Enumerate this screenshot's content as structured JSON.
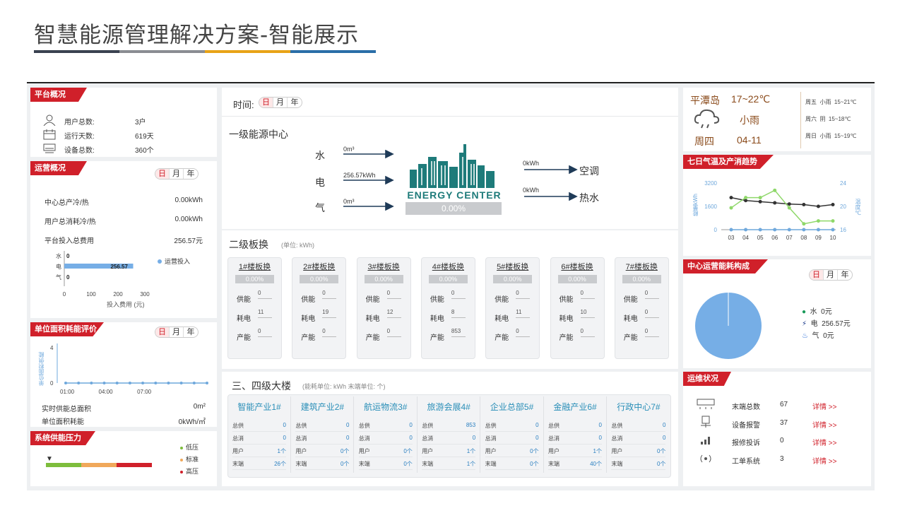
{
  "page": {
    "title": "智慧能源管理解决方案-智能展示",
    "title_bar_colors": [
      "#3a4250",
      "#8a8d92",
      "#e8a317",
      "#2a6ea8"
    ]
  },
  "platform": {
    "tag": "平台概况",
    "rows": [
      {
        "icon": "user-icon",
        "label": "用户总数:",
        "value": "3户"
      },
      {
        "icon": "calendar-icon",
        "label": "运行天数:",
        "value": "619天"
      },
      {
        "icon": "device-icon",
        "label": "设备总数:",
        "value": "360个"
      }
    ]
  },
  "operation": {
    "tag": "运营概况",
    "toggle": [
      "日",
      "月",
      "年"
    ],
    "rows": [
      {
        "label": "中心总产冷/热",
        "value": "0.00kWh"
      },
      {
        "label": "用户总消耗冷/热",
        "value": "0.00kWh"
      },
      {
        "label": "平台投入总费用",
        "value": "256.57元"
      }
    ],
    "legend": "运营投入",
    "xlabel": "投入费用 (元)"
  },
  "op_chart": {
    "type": "bar",
    "categories": [
      "水",
      "电",
      "气"
    ],
    "values": [
      0,
      256.57,
      0
    ],
    "value_labels": [
      "0",
      "256.57",
      "0"
    ],
    "xticks": [
      "0",
      "100",
      "200",
      "300"
    ],
    "xlim": [
      0,
      300
    ]
  },
  "unit_area": {
    "tag": "单位面积耗能评价",
    "toggle": [
      "日",
      "月",
      "年"
    ],
    "ylabel": "单位面积供能",
    "rows": [
      {
        "label": "实时供能总面积",
        "value": "0m²"
      },
      {
        "label": "单位面积耗能",
        "value": "0kWh/㎡"
      }
    ]
  },
  "unit_chart": {
    "type": "line",
    "yticks": [
      "4",
      "0"
    ],
    "xticks": [
      "01:00",
      "04:00",
      "07:00"
    ],
    "ylim": [
      0,
      4
    ],
    "points": [
      0,
      0,
      0,
      0,
      0,
      0,
      0,
      0,
      0,
      0,
      0,
      0
    ]
  },
  "pressure": {
    "tag": "系统供能压力",
    "legend": [
      {
        "label": "低压",
        "color": "#7dbd3c"
      },
      {
        "label": "标准",
        "color": "#f0a85a"
      },
      {
        "label": "高压",
        "color": "#d0202a"
      }
    ]
  },
  "center": {
    "time_label": "时间:",
    "toggle": [
      "日",
      "月",
      "年"
    ],
    "primary_title": "一级能源中心",
    "inputs": [
      {
        "name": "水",
        "value": "0m³"
      },
      {
        "name": "电",
        "value": "256.57kWh"
      },
      {
        "name": "气",
        "value": "0m³"
      }
    ],
    "center_label": "ENERGY CENTER",
    "center_percent": "0.00%",
    "outputs": [
      {
        "value": "0kWh",
        "name": "空调"
      },
      {
        "value": "0kWh",
        "name": "热水"
      }
    ]
  },
  "exchangers": {
    "title": "二级板换",
    "unit": "(单位: kWh)",
    "labels": [
      "供能",
      "耗电",
      "产能"
    ],
    "cards": [
      {
        "name": "1#楼板换",
        "percent": "0.00%",
        "supply": "0",
        "power": "11",
        "produce": "0"
      },
      {
        "name": "2#楼板换",
        "percent": "0.00%",
        "supply": "0",
        "power": "19",
        "produce": "0"
      },
      {
        "name": "3#楼板换",
        "percent": "0.00%",
        "supply": "0",
        "power": "12",
        "produce": "0"
      },
      {
        "name": "4#楼板换",
        "percent": "0.00%",
        "supply": "0",
        "power": "8",
        "produce": "853"
      },
      {
        "name": "5#楼板换",
        "percent": "0.00%",
        "supply": "0",
        "power": "11",
        "produce": "0"
      },
      {
        "name": "6#楼板换",
        "percent": "0.00%",
        "supply": "0",
        "power": "10",
        "produce": "0"
      },
      {
        "name": "7#楼板换",
        "percent": "0.00%",
        "supply": "0",
        "power": "0",
        "produce": "0"
      }
    ]
  },
  "buildings": {
    "title": "三、四级大楼",
    "unit": "(能耗单位: kWh  末端单位: 个)",
    "labels": [
      "总供",
      "总消",
      "用户",
      "末端"
    ],
    "items": [
      {
        "name": "智能产业1#",
        "supply": "0",
        "consume": "0",
        "users": "1个",
        "ends": "26个"
      },
      {
        "name": "建筑产业2#",
        "supply": "0",
        "consume": "0",
        "users": "0个",
        "ends": "0个"
      },
      {
        "name": "航运物流3#",
        "supply": "0",
        "consume": "0",
        "users": "0个",
        "ends": "0个"
      },
      {
        "name": "旅游会展4#",
        "supply": "853",
        "consume": "0",
        "users": "1个",
        "ends": "1个"
      },
      {
        "name": "企业总部5#",
        "supply": "0",
        "consume": "0",
        "users": "0个",
        "ends": "0个"
      },
      {
        "name": "金融产业6#",
        "supply": "0",
        "consume": "0",
        "users": "1个",
        "ends": "40个"
      },
      {
        "name": "行政中心7#",
        "supply": "0",
        "consume": "0",
        "users": "0个",
        "ends": "0个"
      }
    ]
  },
  "weather": {
    "city": "平潭岛",
    "temp": "17~22℃",
    "condition": "小雨",
    "weekday": "周四",
    "date": "04-11",
    "forecast": [
      {
        "day": "周五",
        "cond": "小雨",
        "temp": "15~21℃"
      },
      {
        "day": "周六",
        "cond": "阴",
        "temp": "15~18℃"
      },
      {
        "day": "周日",
        "cond": "小雨",
        "temp": "15~19℃"
      }
    ]
  },
  "trend": {
    "tag": "七日气温及产消趋势",
    "ylabel_left": "能量kWh",
    "ylabel_right": "温度℃"
  },
  "trend_chart": {
    "type": "line",
    "x": [
      "03",
      "04",
      "05",
      "06",
      "07",
      "08",
      "09",
      "10"
    ],
    "left_ticks": [
      "3200",
      "1600",
      "0"
    ],
    "right_ticks": [
      "24",
      "20",
      "16"
    ],
    "ylim_left": [
      0,
      3200
    ],
    "ylim_right": [
      16,
      24
    ],
    "series": [
      {
        "axis": "right",
        "color": "#333333",
        "values": [
          21.5,
          21,
          20.8,
          20.6,
          20.4,
          20.3,
          20,
          20.3
        ]
      },
      {
        "axis": "left",
        "color": "#8fd86a",
        "values": [
          1500,
          2200,
          2200,
          2700,
          1500,
          400,
          600,
          600
        ]
      },
      {
        "axis": "left",
        "color": "#6fa8dc",
        "values": [
          0,
          0,
          0,
          0,
          0,
          0,
          0,
          0
        ]
      }
    ]
  },
  "composition": {
    "tag": "中心运营能耗构成",
    "toggle": [
      "日",
      "月",
      "年"
    ],
    "legend": [
      {
        "icon": "water-drop-icon",
        "color": "#1a9a5a",
        "label": "水",
        "value": "0元"
      },
      {
        "icon": "lightning-icon",
        "color": "#1a3a8a",
        "label": "电",
        "value": "256.57元"
      },
      {
        "icon": "flame-icon",
        "color": "#2a6ed8",
        "label": "气",
        "value": "0元"
      }
    ]
  },
  "pie_chart": {
    "type": "pie",
    "categories": [
      "水",
      "电",
      "气"
    ],
    "values": [
      0,
      256.57,
      0
    ],
    "colors": [
      "#1a9a5a",
      "#76aee6",
      "#2a6ed8"
    ]
  },
  "ops": {
    "tag": "运维状况",
    "rows": [
      {
        "icon": "ac-unit-icon",
        "label": "末端总数",
        "value": "67",
        "link": "详情 >>"
      },
      {
        "icon": "alarm-icon",
        "label": "设备报警",
        "value": "37",
        "link": "详情 >>"
      },
      {
        "icon": "signal-icon",
        "label": "报修投诉",
        "value": "0",
        "link": "详情 >>"
      },
      {
        "icon": "wireless-icon",
        "label": "工单系统",
        "value": "3",
        "link": "详情 >>"
      }
    ]
  }
}
